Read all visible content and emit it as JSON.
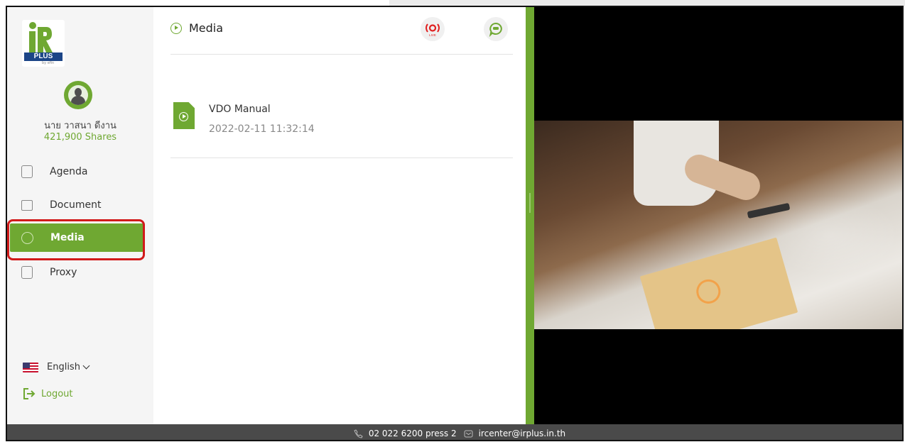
{
  "brand": {
    "logo_text": "PLUS",
    "logo_by": "by efin"
  },
  "user": {
    "name": "นาย วาสนา ดีงาน",
    "shares": "421,900 Shares"
  },
  "nav": {
    "items": [
      {
        "label": "Agenda",
        "icon": "agenda-icon"
      },
      {
        "label": "Document",
        "icon": "folder-icon"
      },
      {
        "label": "Media",
        "icon": "play-icon",
        "active": true
      },
      {
        "label": "Proxy",
        "icon": "proxy-icon"
      }
    ]
  },
  "language": {
    "selected": "English",
    "icon": "us-flag-icon"
  },
  "logout": {
    "label": "Logout"
  },
  "main": {
    "title": "Media",
    "live_label": "LIVE",
    "files": [
      {
        "name": "VDO Manual",
        "date": "2022-02-11 11:32:14"
      }
    ]
  },
  "footer": {
    "phone": "02 022 6200 press 2",
    "email": "ircenter@irplus.in.th"
  },
  "colors": {
    "accent": "#6fa832",
    "highlight": "#d11a1a",
    "footer_bg": "#4a4a4a",
    "sidebar_bg": "#f5f5f5"
  }
}
